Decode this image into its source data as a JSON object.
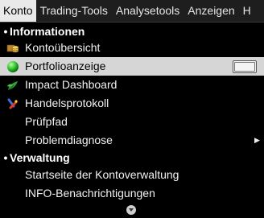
{
  "menubar": {
    "items": [
      {
        "label": "Konto"
      },
      {
        "label": "Trading-Tools"
      },
      {
        "label": "Analysetools"
      },
      {
        "label": "Anzeigen"
      },
      {
        "label": "H"
      }
    ]
  },
  "dropdown": {
    "section1": {
      "bullet": "•",
      "label": "Informationen"
    },
    "items1": [
      {
        "label": "Kontoübersicht",
        "icon": "coins-icon"
      },
      {
        "label": "Portfolioanzeige",
        "icon": "portfolio-globe-icon"
      },
      {
        "label": "Impact Dashboard",
        "icon": "leaf-icon"
      },
      {
        "label": "Handelsprotokoll",
        "icon": "trade-log-icon"
      },
      {
        "label": "Prüfpfad"
      },
      {
        "label": "Problemdiagnose",
        "submenu_arrow": "▶"
      }
    ],
    "section2": {
      "bullet": "•",
      "label": "Verwaltung"
    },
    "items2": [
      {
        "label": "Startseite der Kontoverwaltung"
      },
      {
        "label": "INFO-Benachrichtigungen"
      }
    ]
  }
}
